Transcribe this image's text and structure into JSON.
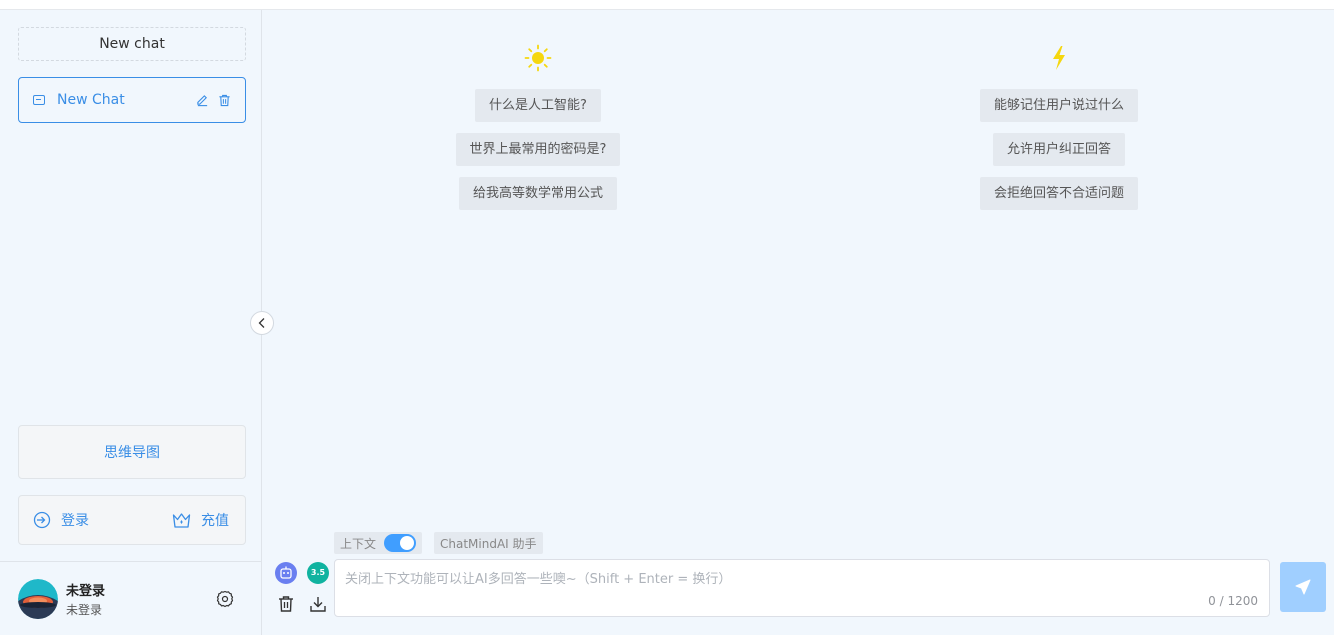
{
  "sidebar": {
    "new_chat_button": "New chat",
    "chats": [
      {
        "title": "New Chat",
        "active": true
      }
    ],
    "mindmap_button": "思维导图",
    "login_label": "登录",
    "recharge_label": "充值",
    "user": {
      "name": "未登录",
      "status": "未登录"
    }
  },
  "main": {
    "columns": [
      {
        "icon": "sun-icon",
        "suggestions": [
          "什么是人工智能?",
          "世界上最常用的密码是?",
          "给我高等数学常用公式"
        ]
      },
      {
        "icon": "lightning-icon",
        "suggestions": [
          "能够记住用户说过什么",
          "允许用户纠正回答",
          "会拒绝回答不合适问题"
        ]
      }
    ],
    "context_label": "上下文",
    "context_enabled": true,
    "assistant_label": "ChatMindAI 助手",
    "model_badge": "3.5",
    "input": {
      "placeholder": "关闭上下文功能可以让AI多回答一些噢~（Shift + Enter = 换行）",
      "value": "",
      "counter": "0 / 1200"
    }
  },
  "colors": {
    "accent": "#3a8ee6",
    "background": "#f1f7fd",
    "send_button": "#a0cfff",
    "sun": "#f5d70f",
    "lightning": "#f5d70f",
    "model_badge": "#10b3a0"
  }
}
